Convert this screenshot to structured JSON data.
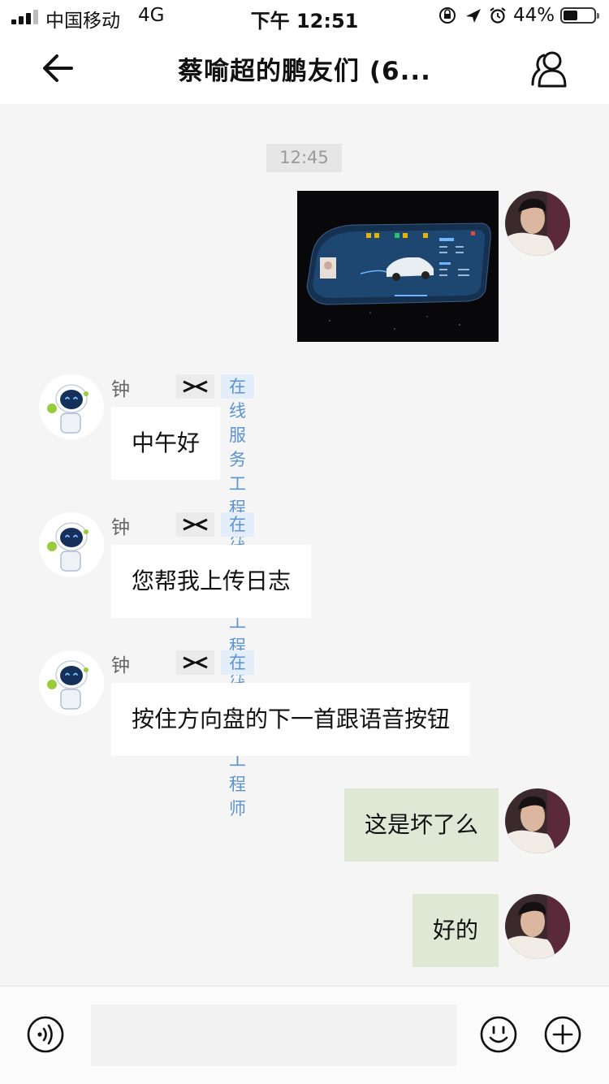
{
  "status_bar": {
    "carrier": "中国移动",
    "network": "4G",
    "time": "下午 12:51",
    "battery": "44%",
    "battery_level": 0.44
  },
  "header": {
    "title": "蔡喻超的鹏友们 (6..."
  },
  "chat": {
    "timestamp": "12:45",
    "sender": {
      "name": "钟双得",
      "role_tag": "在线服务工程师"
    },
    "messages": [
      "中午好",
      "您帮我上传日志",
      "按住方向盘的下一首跟语音按钮",
      "这是坏了么",
      "好的"
    ]
  },
  "icons": {
    "back": "back-arrow-icon",
    "members": "group-members-icon",
    "voice": "voice-input-icon",
    "emoji": "emoji-icon",
    "plus": "plus-icon",
    "brand": "xpeng-logo-icon"
  },
  "colors": {
    "background": "#f5f5f5",
    "outgoing_bubble": "#dfe8d4",
    "incoming_bubble": "#ffffff",
    "tag_text": "#5b93d3",
    "tag_bg": "#e4eefa"
  }
}
